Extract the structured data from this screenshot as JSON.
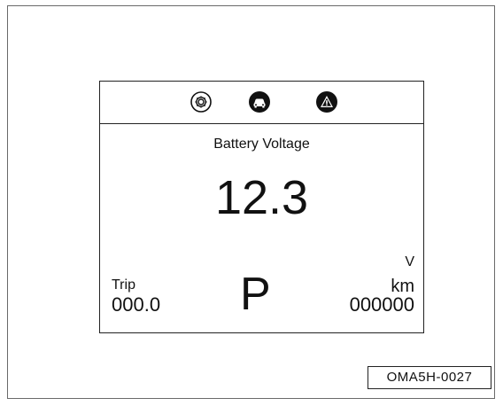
{
  "display": {
    "icons": [
      "gear-icon",
      "car-icon",
      "warning-triangle-icon"
    ],
    "title": "Battery Voltage",
    "value": "12.3",
    "value_unit": "V",
    "trip_label": "Trip",
    "trip_value": "000.0",
    "gear_position": "P",
    "odo_unit": "km",
    "odo_value": "000000"
  },
  "figure": {
    "reference_code": "OMA5H-0027"
  }
}
